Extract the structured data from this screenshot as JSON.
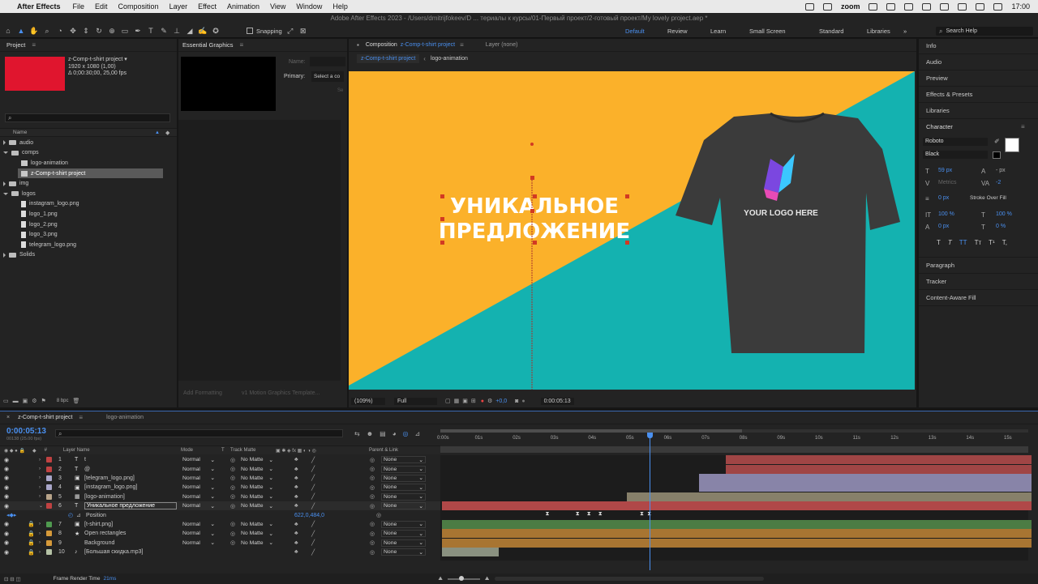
{
  "menubar": {
    "app": "After Effects",
    "items": [
      "File",
      "Edit",
      "Composition",
      "Layer",
      "Effect",
      "Animation",
      "View",
      "Window",
      "Help"
    ],
    "zoom": "zoom",
    "clock": "17:00"
  },
  "window_title": "Adobe After Effects 2023 - /Users/dmitrijfokeev/D ... териалы к курсы/01-Первый проект/2-готовый проект/My lovely project.aep *",
  "toolbar": {
    "snapping": "Snapping",
    "workspaces": [
      "Default",
      "Review",
      "Learn",
      "Small Screen",
      "Standard",
      "Libraries"
    ],
    "active_workspace": "Default",
    "search_placeholder": "Search Help"
  },
  "project": {
    "title": "Project",
    "comp_name": "z-Comp-t-shirt project ▾",
    "comp_size": "1920 x 1080 (1,00)",
    "comp_duration": "Δ 0;00:30;00, 25,00 fps",
    "search_placeholder": "",
    "col_name": "Name",
    "bpc": "8 bpc",
    "thumb_color": "#e0152e",
    "rows": [
      {
        "label": "audio",
        "type": "folder",
        "open": false,
        "indent": 0
      },
      {
        "label": "comps",
        "type": "folder",
        "open": true,
        "indent": 0
      },
      {
        "label": "logo-animation",
        "type": "comp",
        "indent": 1
      },
      {
        "label": "z-Comp-t-shirt project",
        "type": "comp",
        "indent": 1,
        "selected": true
      },
      {
        "label": "img",
        "type": "folder",
        "open": false,
        "indent": 0
      },
      {
        "label": "logos",
        "type": "folder",
        "open": true,
        "indent": 0
      },
      {
        "label": "instagram_logo.png",
        "type": "file",
        "indent": 1
      },
      {
        "label": "logo_1.png",
        "type": "file",
        "indent": 1
      },
      {
        "label": "logo_2.png",
        "type": "file",
        "indent": 1
      },
      {
        "label": "logo_3.png",
        "type": "file",
        "indent": 1
      },
      {
        "label": "telegram_logo.png",
        "type": "file",
        "indent": 1
      },
      {
        "label": "Solids",
        "type": "folder",
        "open": false,
        "indent": 0
      }
    ]
  },
  "essential_graphics": {
    "title": "Essential Graphics",
    "name_label": "Name:",
    "primary_label": "Primary:",
    "primary_value": "Select a co",
    "so_label": "Se",
    "add_formatting": "Add Formatting",
    "template": "v1 Motion Graphics Template..."
  },
  "composition": {
    "tab_label": "Composition",
    "tab_comp": "z-Comp-t-shirt project",
    "layer_tab": "Layer (none)",
    "crumbs": [
      "z-Comp-t-shirt project",
      "logo-animation"
    ],
    "headline_line1": "УНИКАЛЬНОЕ",
    "headline_line2": "ПРЕДЛОЖЕНИЕ",
    "shirt_text": "YOUR LOGO HERE",
    "zoom": "(109%)",
    "resolution": "Full",
    "exposure": "+0,0",
    "timecode": "0:00:05:13",
    "bg_yellow": "#fbb12a",
    "bg_teal": "#14b2b0"
  },
  "right_panel": {
    "items_top": [
      "Info",
      "Audio",
      "Preview",
      "Effects & Presets",
      "Libraries"
    ],
    "character": "Character",
    "font": "Roboto",
    "style": "Black",
    "font_size": "59 px",
    "leading": "- px",
    "kerning": "Metrics",
    "tracking": "-2",
    "stroke": "0 px",
    "stroke_type": "Stroke Over Fill",
    "v_scale": "100 %",
    "h_scale": "100 %",
    "baseline": "0 px",
    "tsume": "0 %",
    "format_buttons": [
      "T",
      "T",
      "TT",
      "Tт",
      "T¹",
      "T,"
    ],
    "items_bottom": [
      "Paragraph",
      "Tracker",
      "Content-Aware Fill"
    ]
  },
  "timeline": {
    "tab_active": "z-Comp-t-shirt project",
    "tab_other": "logo-animation",
    "timecode": "0:00:05:13",
    "frames": "00138 (25.00 fps)",
    "col_layer": "Layer Name",
    "col_mode": "Mode",
    "col_t": "T",
    "col_matte": "Track Matte",
    "col_parent": "Parent & Link",
    "col_num": "#",
    "ruler": [
      "0:00s",
      "01s",
      "02s",
      "03s",
      "04s",
      "05s",
      "06s",
      "07s",
      "08s",
      "09s",
      "10s",
      "11s",
      "12s",
      "13s",
      "14s",
      "15s"
    ],
    "playhead_seconds": 5.5,
    "layers": [
      {
        "num": "1",
        "icon": "T",
        "name": "t",
        "mode": "Normal",
        "matte": "No Matte",
        "parent": "None",
        "color": "#c04242",
        "bar_start": 7.5,
        "bar_end": 15.6,
        "bar_color": "#a04545"
      },
      {
        "num": "2",
        "icon": "T",
        "name": "@",
        "mode": "Normal",
        "matte": "No Matte",
        "parent": "None",
        "color": "#c04242",
        "bar_start": 7.5,
        "bar_end": 15.6,
        "bar_color": "#a04545"
      },
      {
        "num": "3",
        "icon": "▣",
        "name": "[telegram_logo.png]",
        "mode": "Normal",
        "matte": "No Matte",
        "parent": "None",
        "color": "#a9a6c9",
        "bar_start": 6.8,
        "bar_end": 15.6,
        "bar_color": "#8884a8"
      },
      {
        "num": "4",
        "icon": "▣",
        "name": "[instagram_logo.png]",
        "mode": "Normal",
        "matte": "No Matte",
        "parent": "None",
        "color": "#a9a6c9",
        "bar_start": 6.8,
        "bar_end": 15.6,
        "bar_color": "#8884a8"
      },
      {
        "num": "5",
        "icon": "▦",
        "name": "[logo-animation]",
        "mode": "Normal",
        "matte": "No Matte",
        "parent": "None",
        "color": "#b8a48a",
        "bar_start": 4.9,
        "bar_end": 15.6,
        "bar_color": "#87806a"
      },
      {
        "num": "6",
        "icon": "T",
        "name": "Уникальное предложение",
        "mode": "Normal",
        "matte": "No Matte",
        "parent": "None",
        "color": "#c04242",
        "bar_start": 0,
        "bar_end": 15.6,
        "bar_color": "#b04848",
        "selected": true
      },
      {
        "num": "7",
        "icon": "▣",
        "name": "[t-shirt.png]",
        "mode": "Normal",
        "matte": "No Matte",
        "parent": "None",
        "color": "#4f9a4f",
        "bar_start": 0,
        "bar_end": 15.6,
        "bar_color": "#4c7c44"
      },
      {
        "num": "8",
        "icon": "★",
        "name": "Open rectangles",
        "mode": "Normal",
        "matte": "No Matte",
        "parent": "None",
        "color": "#d69a3a",
        "bar_start": 0,
        "bar_end": 15.6,
        "bar_color": "#a87532"
      },
      {
        "num": "9",
        "icon": "",
        "name": "Background",
        "mode": "Normal",
        "matte": "No Matte",
        "parent": "None",
        "color": "#d69a3a",
        "bar_start": 0,
        "bar_end": 15.6,
        "bar_color": "#a87532"
      },
      {
        "num": "10",
        "icon": "♪",
        "name": "[Большая скидка.mp3]",
        "mode": "",
        "matte": "",
        "parent": "None",
        "color": "#b5c2a5",
        "bar_start": 0,
        "bar_end": 1.5,
        "bar_color": "#8a9180"
      }
    ],
    "position_label": "Position",
    "position_value": "622,0,484,0",
    "keyframes_seconds": [
      2.8,
      3.6,
      3.9,
      4.2,
      5.3,
      5.5
    ],
    "footer": "Frame Render Time",
    "render_time": "21ms"
  }
}
